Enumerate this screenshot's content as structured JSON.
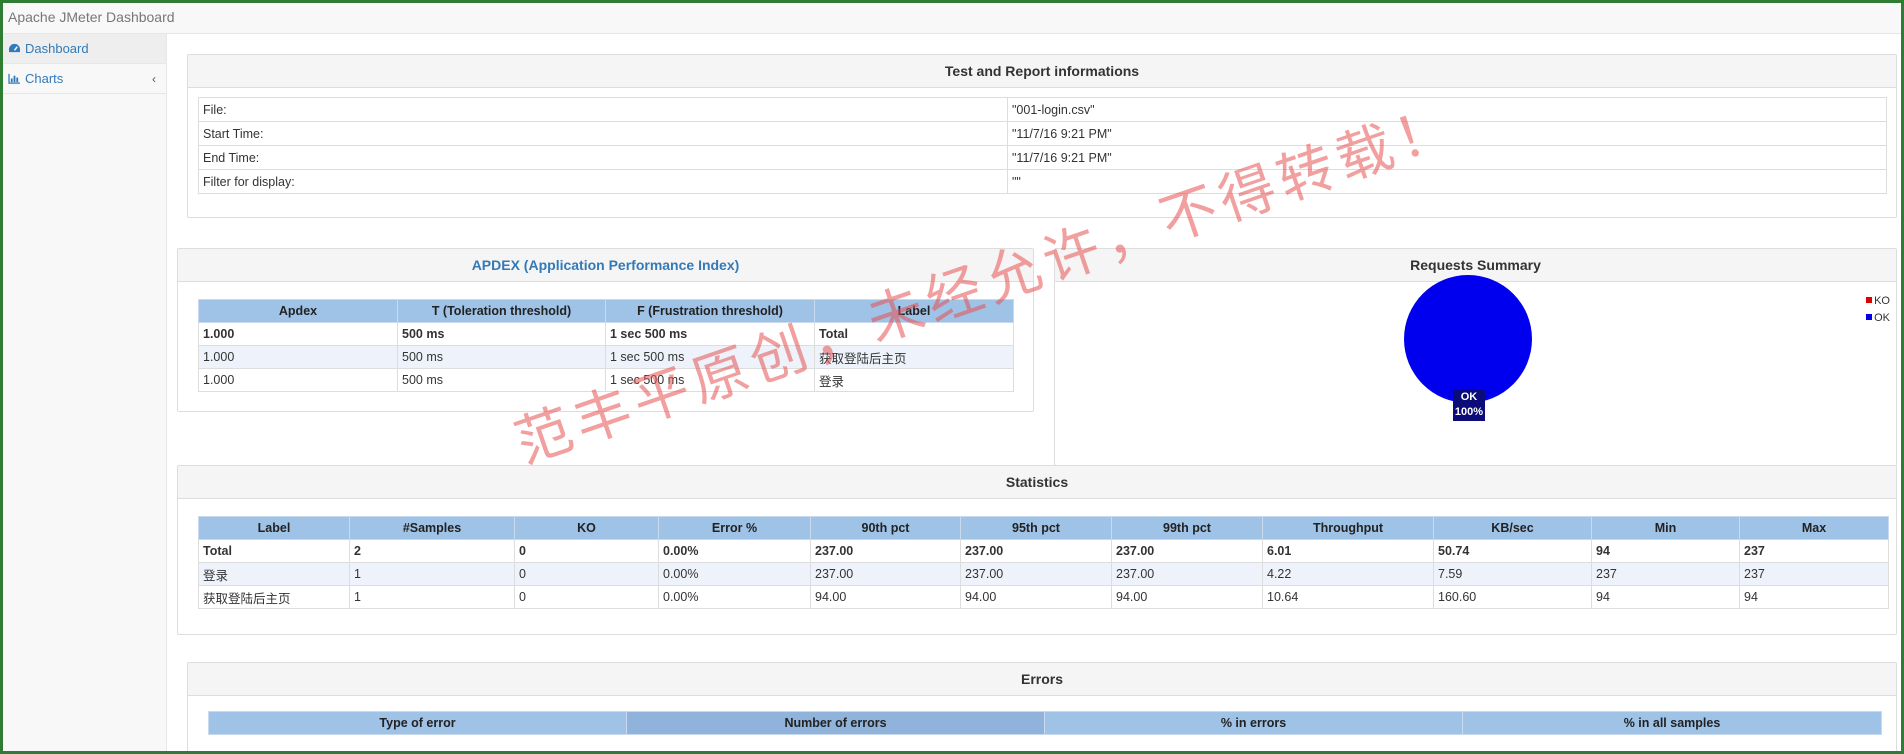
{
  "app": {
    "title": "Apache JMeter Dashboard"
  },
  "sidebar": {
    "items": [
      {
        "label": "Dashboard",
        "icon": "dashboard-icon",
        "active": true
      },
      {
        "label": "Charts",
        "icon": "bar-chart-icon",
        "expand_icon": "‹"
      }
    ]
  },
  "test_info": {
    "title": "Test and Report informations",
    "rows": [
      {
        "key": "File:",
        "value": "\"001-login.csv\""
      },
      {
        "key": "Start Time:",
        "value": "\"11/7/16 9:21 PM\""
      },
      {
        "key": "End Time:",
        "value": "\"11/7/16 9:21 PM\""
      },
      {
        "key": "Filter for display:",
        "value": "\"\""
      }
    ]
  },
  "apdex": {
    "title": "APDEX (Application Performance Index)",
    "headers": [
      "Apdex",
      "T (Toleration threshold)",
      "F (Frustration threshold)",
      "Label"
    ],
    "rows": [
      [
        "1.000",
        "500 ms",
        "1 sec 500 ms",
        "Total"
      ],
      [
        "1.000",
        "500 ms",
        "1 sec 500 ms",
        "获取登陆后主页"
      ],
      [
        "1.000",
        "500 ms",
        "1 sec 500 ms",
        "登录"
      ]
    ]
  },
  "requests_summary": {
    "title": "Requests Summary",
    "legend": [
      {
        "label": "KO",
        "color": "#e00000"
      },
      {
        "label": "OK",
        "color": "#0000ee"
      }
    ],
    "slice_label": "OK",
    "slice_percent": "100%"
  },
  "chart_data": {
    "type": "pie",
    "title": "Requests Summary",
    "categories": [
      "KO",
      "OK"
    ],
    "values": [
      0,
      100
    ],
    "colors": [
      "#e00000",
      "#0000ee"
    ],
    "legend_position": "top-right"
  },
  "statistics": {
    "title": "Statistics",
    "headers": [
      "Label",
      "#Samples",
      "KO",
      "Error %",
      "90th pct",
      "95th pct",
      "99th pct",
      "Throughput",
      "KB/sec",
      "Min",
      "Max"
    ],
    "rows": [
      [
        "Total",
        "2",
        "0",
        "0.00%",
        "237.00",
        "237.00",
        "237.00",
        "6.01",
        "50.74",
        "94",
        "237"
      ],
      [
        "登录",
        "1",
        "0",
        "0.00%",
        "237.00",
        "237.00",
        "237.00",
        "4.22",
        "7.59",
        "237",
        "237"
      ],
      [
        "获取登陆后主页",
        "1",
        "0",
        "0.00%",
        "94.00",
        "94.00",
        "94.00",
        "10.64",
        "160.60",
        "94",
        "94"
      ]
    ]
  },
  "errors": {
    "title": "Errors",
    "headers": [
      "Type of error",
      "Number of errors",
      "% in errors",
      "% in all samples"
    ]
  },
  "watermark": "范丰平原创，未经允许，不得转载！"
}
